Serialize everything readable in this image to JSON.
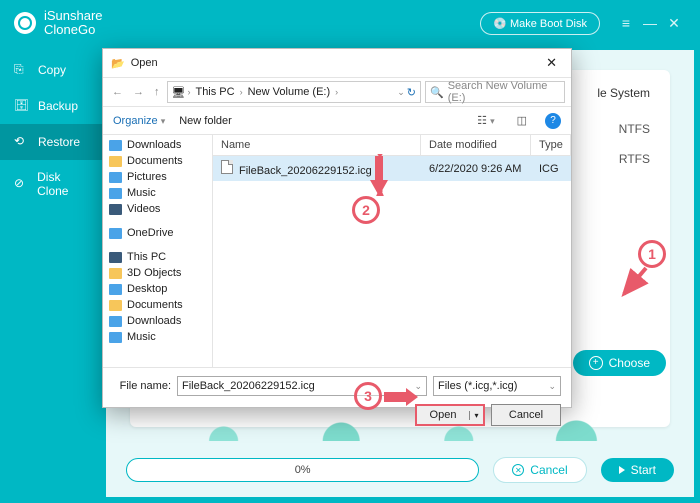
{
  "app": {
    "name_line1": "iSunshare",
    "name_line2": "CloneGo",
    "make_boot": "Make Boot Disk"
  },
  "sidebar": {
    "items": [
      {
        "label": "Copy"
      },
      {
        "label": "Backup"
      },
      {
        "label": "Restore"
      },
      {
        "label": "Disk Clone"
      }
    ]
  },
  "main": {
    "fs_label": "le System",
    "fs_value_1": "NTFS",
    "fs_value_2": "RTFS",
    "choose": "Choose"
  },
  "bottom": {
    "progress": "0%",
    "cancel": "Cancel",
    "start": "Start"
  },
  "dialog": {
    "title": "Open",
    "path": {
      "root_icon": "pc",
      "seg1": "This PC",
      "seg2": "New Volume (E:)"
    },
    "search_placeholder": "Search New Volume (E:)",
    "organize": "Organize",
    "new_folder": "New folder",
    "columns": {
      "name": "Name",
      "date": "Date modified",
      "type": "Type"
    },
    "file": {
      "name": "FileBack_20206229152.icg",
      "date": "6/22/2020 9:26 AM",
      "type": "ICG"
    },
    "tree": [
      "Downloads",
      "Documents",
      "Pictures",
      "Music",
      "Videos",
      "",
      "OneDrive",
      "",
      "This PC",
      "3D Objects",
      "Desktop",
      "Documents",
      "Downloads",
      "Music"
    ],
    "fn_label": "File name:",
    "fn_value": "FileBack_20206229152.icg",
    "filter": "Files (*.icg,*.icg)",
    "open": "Open",
    "cancel": "Cancel"
  },
  "annotations": {
    "a1": "1",
    "a2": "2",
    "a3": "3"
  }
}
